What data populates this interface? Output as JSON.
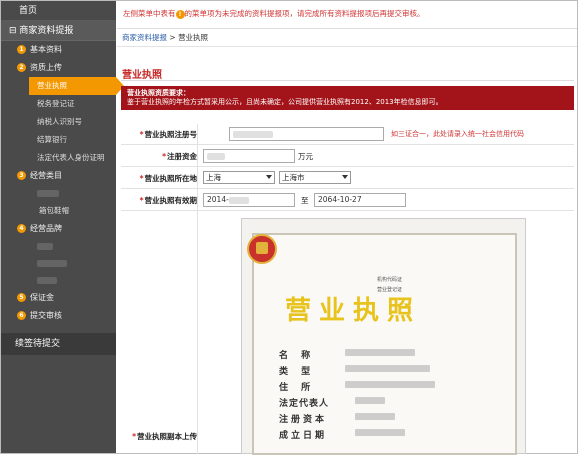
{
  "sidebar": {
    "top": "首页",
    "header": "⊟ 商家资料提报",
    "sections": [
      {
        "num": "1",
        "label": "基本资料"
      },
      {
        "num": "2",
        "label": "资质上传"
      },
      {
        "num": "3",
        "label": "经营类目"
      },
      {
        "num": "4",
        "label": "经营品牌"
      },
      {
        "num": "5",
        "label": "保证金"
      },
      {
        "num": "6",
        "label": "提交审核"
      }
    ],
    "sub_items": [
      "营业执照",
      "税务登记证",
      "纳税人识别号",
      "结算银行",
      "法定代表人身份证明"
    ],
    "category_sub": "箱包鞋帽",
    "bottom": "续签待提交"
  },
  "notice": {
    "pre": "左侧菜单中表有",
    "icon": "!",
    "post": "的菜单项为未完成的资料提报项，请完成所有资料提报项后再提交审核。"
  },
  "breadcrumb": {
    "link": "商家资料提报",
    "sep": " > ",
    "current": "营业执照"
  },
  "page_title": "营业执照",
  "requirements": {
    "title": "营业执照资质要求：",
    "text": "鉴于营业执照的年检方式暂采用公示，且尚未确定，公司提供营业执照有2012、2013年检信息即可。"
  },
  "form": {
    "reg_no_label": "营业执照注册号",
    "reg_no_hint": "如三证合一，此处请录入统一社会信用代码",
    "capital_label": "注册资金",
    "capital_unit": "万元",
    "location_label": "营业执照所在地",
    "province": "上海",
    "city": "上海市",
    "validity_label": "营业执照有效期",
    "valid_from": "2014-",
    "valid_sep": "至",
    "valid_to": "2064-10-27",
    "copy_label": "营业执照副本上传"
  },
  "certificate": {
    "title": "营业执照",
    "fields": [
      "名    称",
      "类    型",
      "住    所",
      "法定代表人",
      "注册资本",
      "成立日期"
    ],
    "small1": "机构代码证",
    "small2": "营业登记证"
  }
}
